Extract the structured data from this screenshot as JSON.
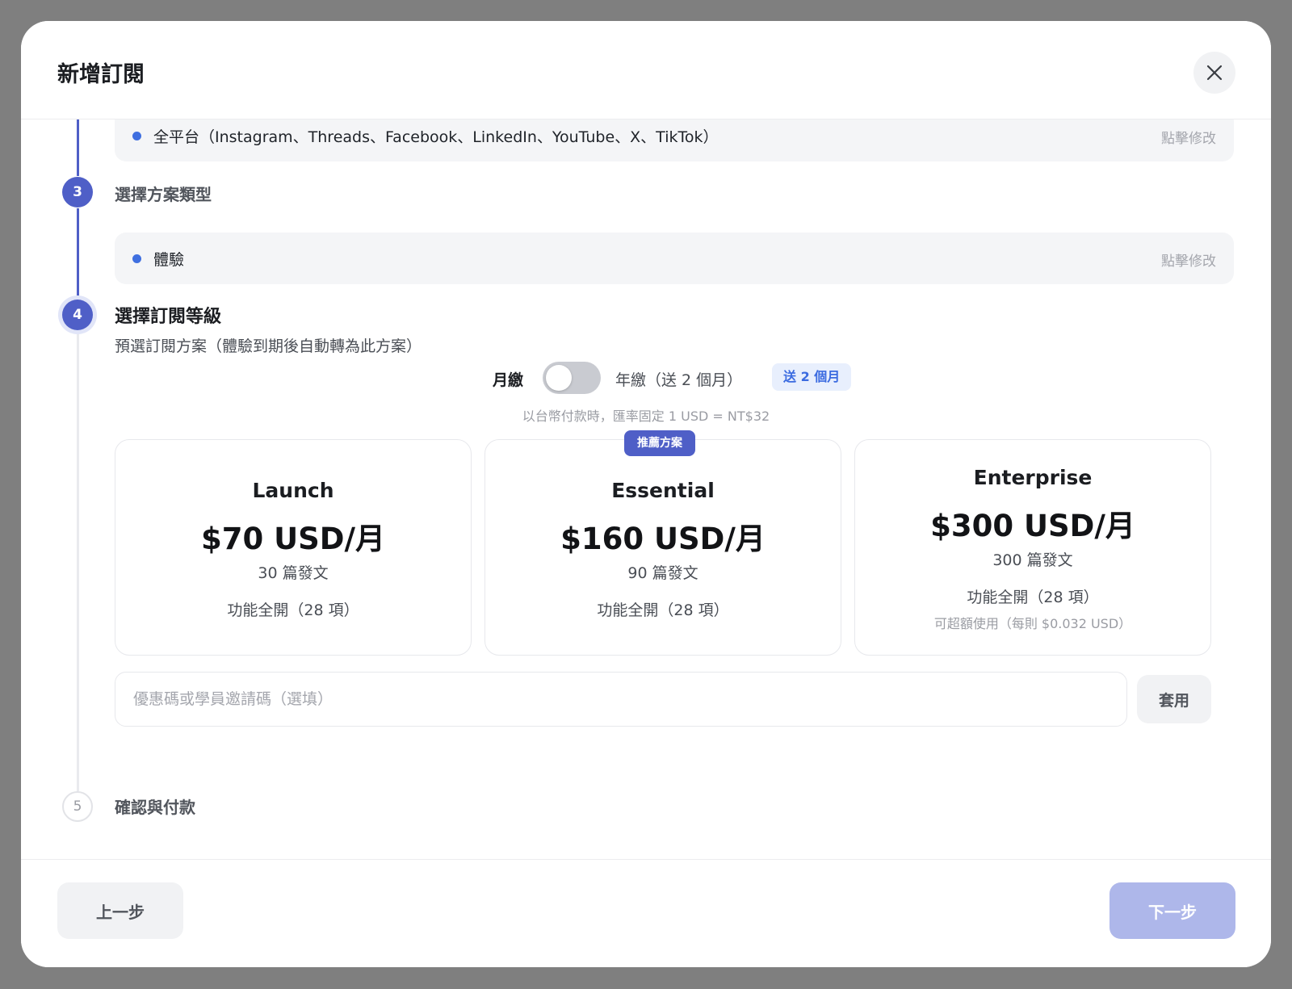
{
  "modal": {
    "title": "新增訂閱",
    "close_icon": "close-icon"
  },
  "steps": {
    "platforms": {
      "summary": "全平台（Instagram、Threads、Facebook、LinkedIn、YouTube、X、TikTok）",
      "edit_label": "點擊修改"
    },
    "plan_type": {
      "number": "3",
      "title": "選擇方案類型",
      "selected": "體驗",
      "edit_label": "點擊修改"
    },
    "tier": {
      "number": "4",
      "title": "選擇訂閱等級",
      "subtitle": "預選訂閱方案（體驗到期後自動轉為此方案）",
      "billing": {
        "monthly_label": "月繳",
        "yearly_label": "年繳（送 2 個月）",
        "bonus_badge": "送 2 個月",
        "yearly_selected": false
      },
      "rate_note": "以台幣付款時，匯率固定 1 USD = NT$32",
      "plans": [
        {
          "name": "Launch",
          "price": "$70 USD/月",
          "posts": "30 篇發文",
          "features": "功能全開（28 項）"
        },
        {
          "name": "Essential",
          "badge": "推薦方案",
          "price": "$160 USD/月",
          "posts": "90 篇發文",
          "features": "功能全開（28 項）"
        },
        {
          "name": "Enterprise",
          "price": "$300 USD/月",
          "posts": "300 篇發文",
          "features": "功能全開（28 項）",
          "overage": "可超額使用（每則 $0.032 USD）"
        }
      ],
      "coupon": {
        "placeholder": "優惠碼或學員邀請碼（選填）",
        "value": "",
        "apply_label": "套用"
      }
    },
    "confirm": {
      "number": "5",
      "title": "確認與付款"
    }
  },
  "footer": {
    "prev_label": "上一步",
    "next_label": "下一步"
  },
  "colors": {
    "accent": "#4f5fc7",
    "accent_disabled": "#aeb7ea",
    "bonus_text": "#3b6be0",
    "bonus_bg": "#e8effd"
  }
}
